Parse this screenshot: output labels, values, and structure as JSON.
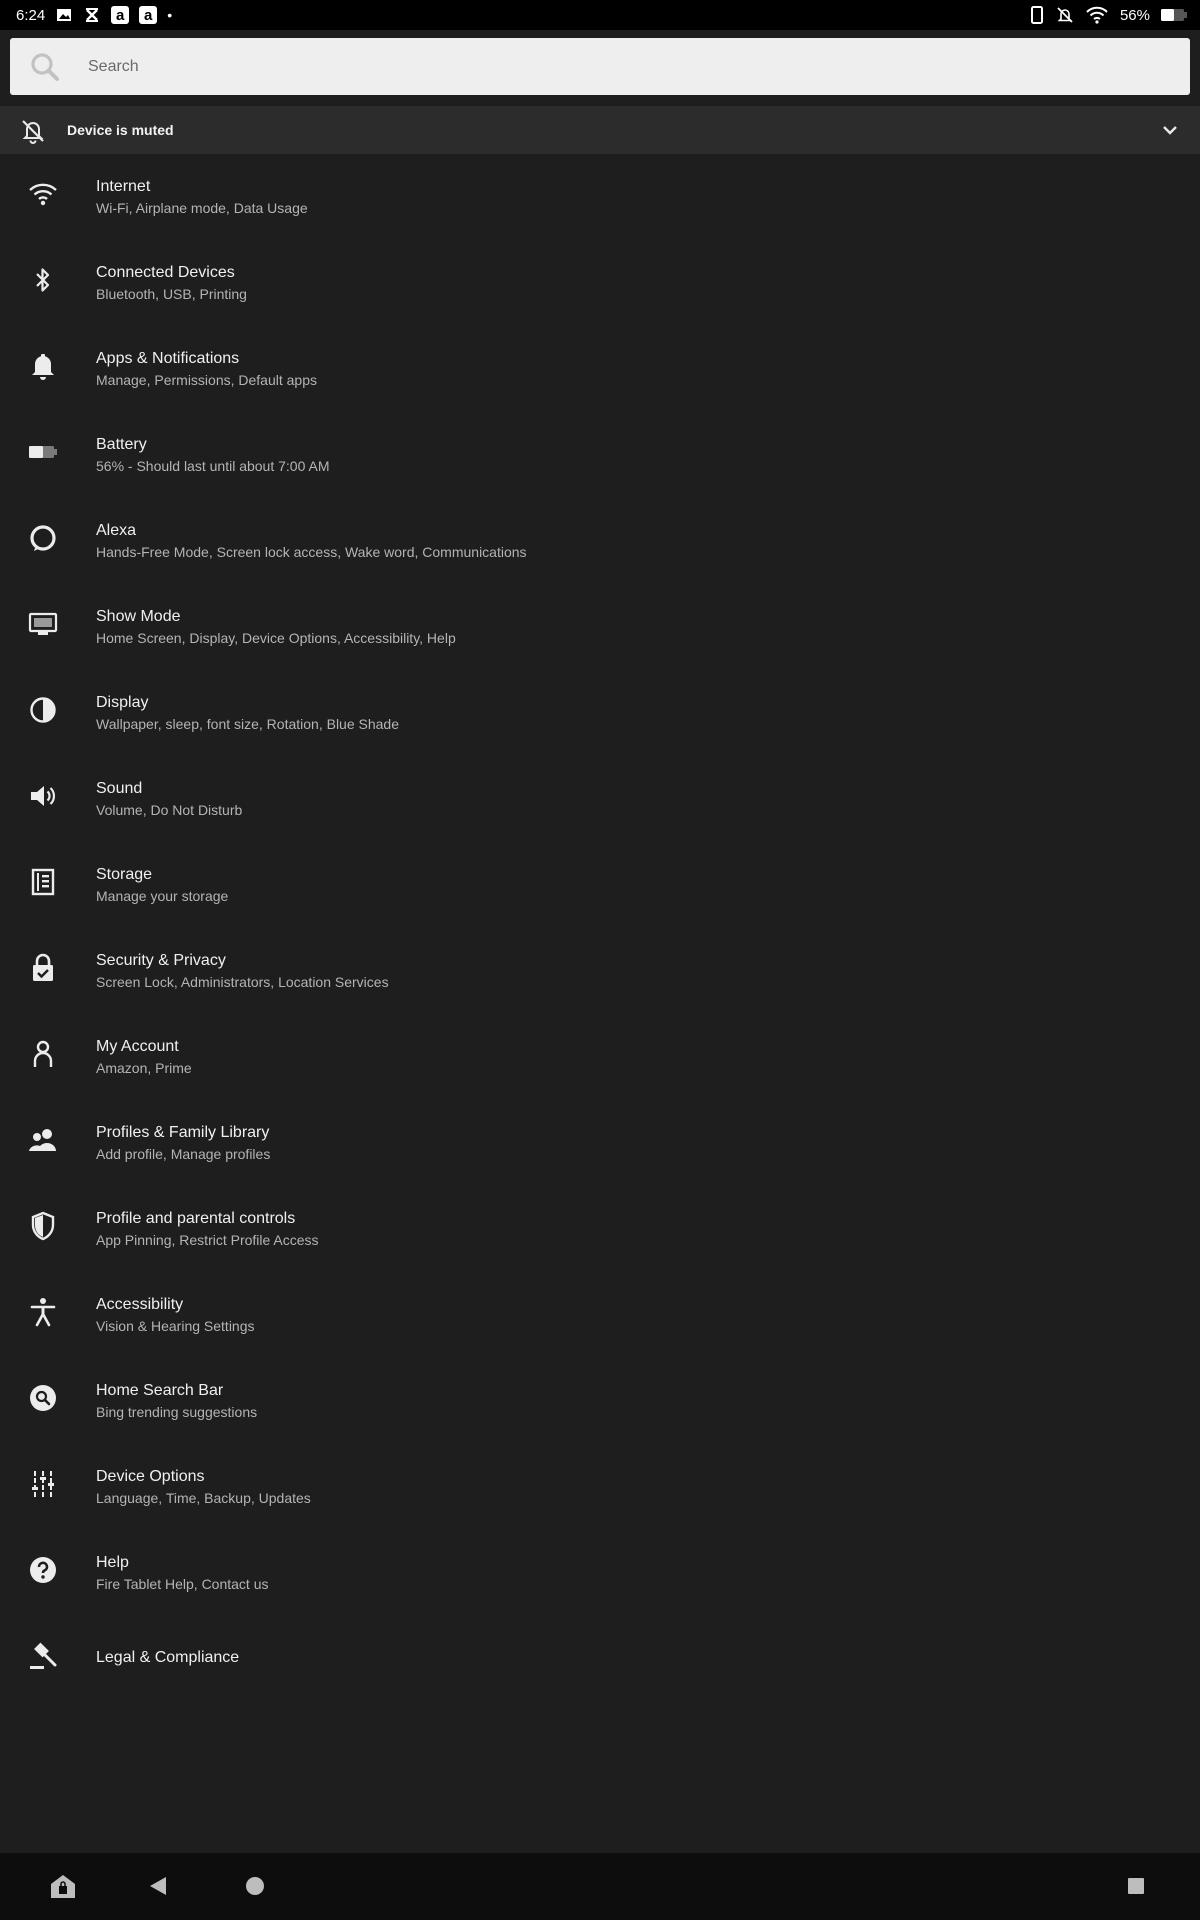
{
  "status_bar": {
    "time": "6:24",
    "battery_percent": "56%",
    "left_icons": [
      "gallery-icon",
      "x-app-icon",
      "amazon-icon",
      "amazon-icon"
    ],
    "right_icons": [
      "tablet-icon",
      "bell-off-icon",
      "wifi-icon",
      "battery-icon"
    ]
  },
  "search": {
    "placeholder": "Search"
  },
  "muted_banner": {
    "label": "Device is muted"
  },
  "settings": [
    {
      "title": "Internet",
      "subtitle": "Wi-Fi, Airplane mode, Data Usage",
      "icon": "wifi-icon"
    },
    {
      "title": "Connected Devices",
      "subtitle": "Bluetooth, USB, Printing",
      "icon": "bluetooth-icon"
    },
    {
      "title": "Apps & Notifications",
      "subtitle": "Manage, Permissions, Default apps",
      "icon": "bell-icon"
    },
    {
      "title": "Battery",
      "subtitle": "56% - Should last until about 7:00 AM",
      "icon": "battery-icon"
    },
    {
      "title": "Alexa",
      "subtitle": "Hands-Free Mode, Screen lock access, Wake word, Communications",
      "icon": "alexa-icon"
    },
    {
      "title": "Show Mode",
      "subtitle": "Home Screen, Display, Device Options, Accessibility, Help",
      "icon": "monitor-icon"
    },
    {
      "title": "Display",
      "subtitle": "Wallpaper, sleep, font size, Rotation, Blue Shade",
      "icon": "contrast-icon"
    },
    {
      "title": "Sound",
      "subtitle": "Volume, Do Not Disturb",
      "icon": "speaker-icon"
    },
    {
      "title": "Storage",
      "subtitle": "Manage your storage",
      "icon": "storage-icon"
    },
    {
      "title": "Security & Privacy",
      "subtitle": "Screen Lock, Administrators, Location Services",
      "icon": "lock-icon"
    },
    {
      "title": "My Account",
      "subtitle": "Amazon, Prime",
      "icon": "person-icon"
    },
    {
      "title": "Profiles & Family Library",
      "subtitle": "Add profile, Manage profiles",
      "icon": "people-icon"
    },
    {
      "title": "Profile and parental controls",
      "subtitle": "App Pinning, Restrict Profile Access",
      "icon": "shield-icon"
    },
    {
      "title": "Accessibility",
      "subtitle": "Vision & Hearing Settings",
      "icon": "accessibility-icon"
    },
    {
      "title": "Home Search Bar",
      "subtitle": "Bing trending suggestions",
      "icon": "search-circle-icon"
    },
    {
      "title": "Device Options",
      "subtitle": "Language, Time, Backup, Updates",
      "icon": "sliders-icon"
    },
    {
      "title": "Help",
      "subtitle": "Fire Tablet Help, Contact us",
      "icon": "help-icon"
    },
    {
      "title": "Legal & Compliance",
      "subtitle": "",
      "icon": "gavel-icon"
    }
  ],
  "nav_bar": {
    "buttons": [
      "home-shop-icon",
      "back-icon",
      "home-icon",
      "recents-icon"
    ]
  }
}
